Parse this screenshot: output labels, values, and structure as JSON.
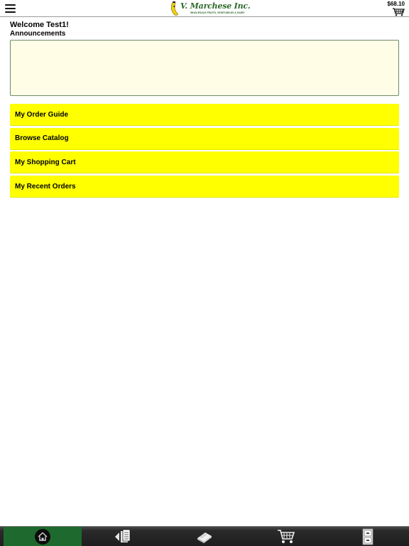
{
  "header": {
    "menu_icon": "hamburger-menu-icon",
    "logo": {
      "name": "V. Marchese Inc.",
      "tagline": "WHOLESALE FRUITS, VEGETABLES & DAIRY"
    },
    "cart_total": "$68.10",
    "cart_icon": "shopping-basket-icon"
  },
  "main": {
    "welcome": "Welcome Test1!",
    "announcements_label": "Announcements",
    "announcements_text": "",
    "menu": [
      {
        "label": "My Order Guide"
      },
      {
        "label": "Browse Catalog"
      },
      {
        "label": "My Shopping Cart"
      },
      {
        "label": "My Recent Orders"
      }
    ]
  },
  "toolbar": {
    "items": [
      {
        "icon": "home-icon",
        "active": true
      },
      {
        "icon": "order-guide-icon",
        "active": false
      },
      {
        "icon": "catalog-book-icon",
        "active": false
      },
      {
        "icon": "shopping-cart-icon",
        "active": false
      },
      {
        "icon": "recent-orders-icon",
        "active": false
      }
    ]
  },
  "colors": {
    "accent_yellow": "#ffff00",
    "announce_bg": "#fffde6",
    "toolbar_active": "#1e6a2e",
    "brand_green": "#2d6b2a"
  }
}
